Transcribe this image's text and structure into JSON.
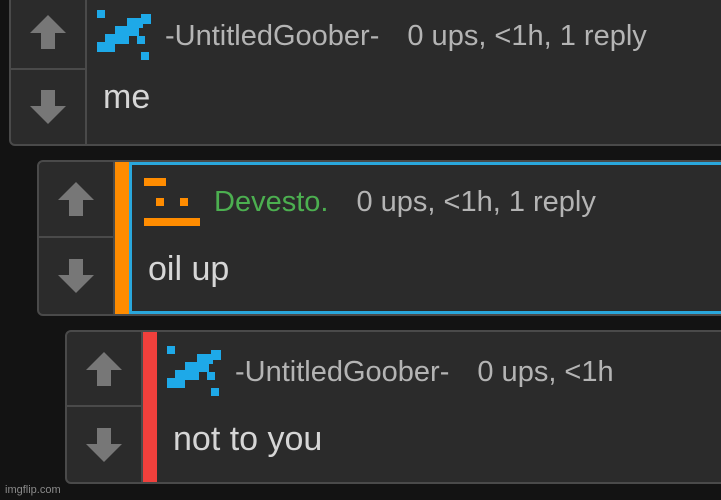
{
  "comments": [
    {
      "username": "-UntitledGoober-",
      "stats": "0 ups, <1h, 1 reply",
      "text": "me",
      "username_color": "#b4b4b4",
      "avatar_icon": "blue-pixel-avatar-icon"
    },
    {
      "username": "Devesto.",
      "stats": "0 ups, <1h, 1 reply",
      "text": "oil up",
      "username_color": "#4caf50",
      "avatar_icon": "orange-pixel-avatar-icon",
      "level_color": "#ff8c00",
      "highlight_color": "#2aa7dc"
    },
    {
      "username": "-UntitledGoober-",
      "stats": "0 ups, <1h",
      "text": "not to you",
      "username_color": "#b4b4b4",
      "avatar_icon": "blue-pixel-avatar-icon",
      "level_color": "#f0403c"
    }
  ],
  "icons": {
    "upvote": "up-arrow-icon",
    "downvote": "down-arrow-icon"
  },
  "watermark": "imgflip.com"
}
